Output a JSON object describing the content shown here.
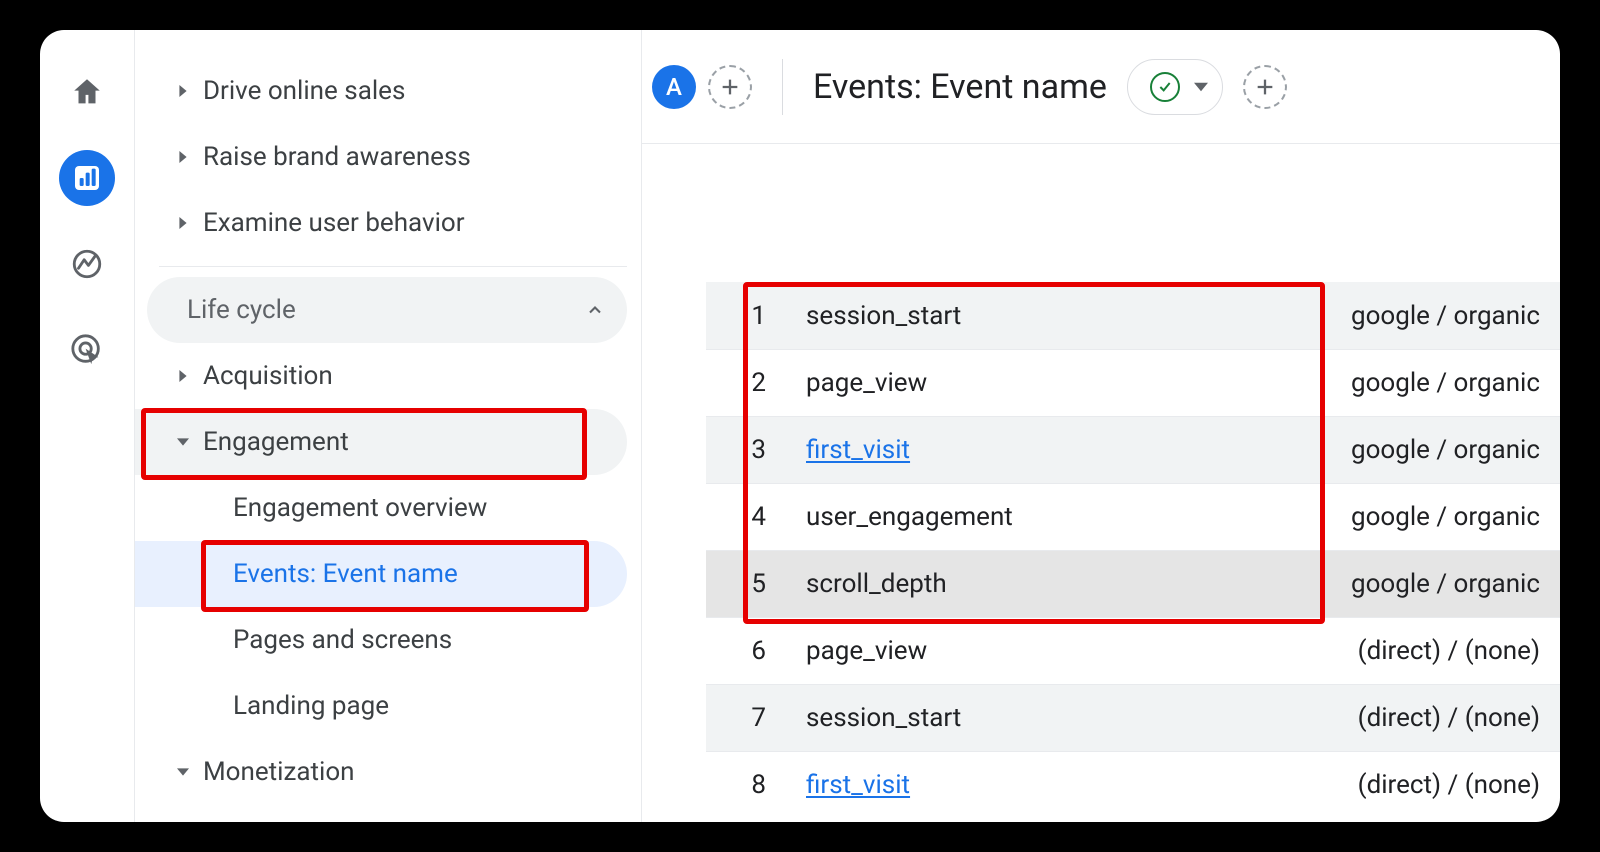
{
  "rail": {
    "home": "home",
    "reports": "reports",
    "explore": "explore",
    "advert": "advertising"
  },
  "sidebar": {
    "items": [
      {
        "label": "Drive online sales"
      },
      {
        "label": "Raise brand awareness"
      },
      {
        "label": "Examine user behavior"
      }
    ],
    "section": "Life cycle",
    "acquisition": "Acquisition",
    "engagement": "Engagement",
    "engagement_overview": "Engagement overview",
    "events": "Events: Event name",
    "pages": "Pages and screens",
    "landing": "Landing page",
    "monetization": "Monetization"
  },
  "topbar": {
    "chip": "A",
    "title": "Events: Event name"
  },
  "table": {
    "rows": [
      {
        "idx": "1",
        "event": "session_start",
        "src": "google / organic",
        "shaded": true,
        "link": false
      },
      {
        "idx": "2",
        "event": "page_view",
        "src": "google / organic",
        "shaded": false,
        "link": false
      },
      {
        "idx": "3",
        "event": "first_visit",
        "src": "google / organic",
        "shaded": true,
        "link": true
      },
      {
        "idx": "4",
        "event": "user_engagement",
        "src": "google / organic",
        "shaded": false,
        "link": false
      },
      {
        "idx": "5",
        "event": "scroll_depth",
        "src": "google / organic",
        "selected": true,
        "link": false
      },
      {
        "idx": "6",
        "event": "page_view",
        "src": "(direct) / (none)",
        "shaded": false,
        "link": false
      },
      {
        "idx": "7",
        "event": "session_start",
        "src": "(direct) / (none)",
        "shaded": true,
        "link": false
      },
      {
        "idx": "8",
        "event": "first_visit",
        "src": "(direct) / (none)",
        "shaded": false,
        "link": true
      }
    ]
  }
}
